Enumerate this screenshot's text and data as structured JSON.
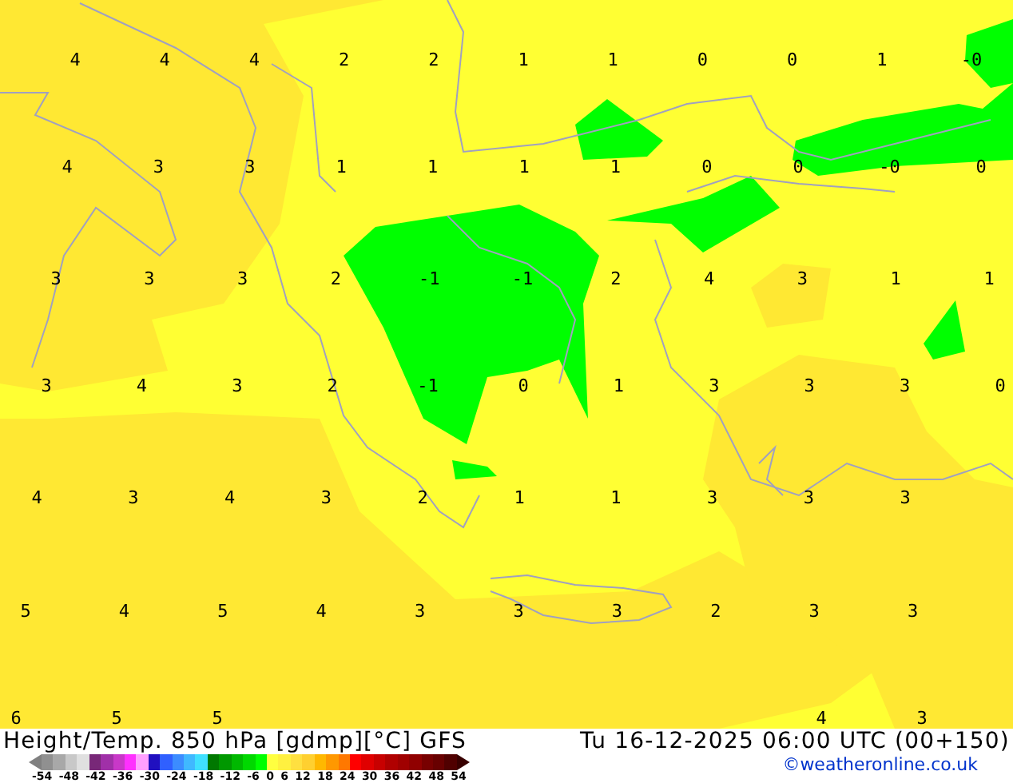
{
  "map": {
    "labels": [
      [
        "4",
        "4",
        "4",
        "2",
        "2",
        "1",
        "1",
        "0",
        "0",
        "1",
        "-0"
      ],
      [
        "4",
        "3",
        "3",
        "1",
        "1",
        "1",
        "1",
        "0",
        "0",
        "-0",
        "0"
      ],
      [
        "3",
        "3",
        "3",
        "2",
        "-1",
        "-1",
        "2",
        "4",
        "3",
        "1",
        "1"
      ],
      [
        "3",
        "4",
        "3",
        "2",
        "-1",
        "0",
        "1",
        "3",
        "3",
        "3",
        "0"
      ],
      [
        "4",
        "3",
        "4",
        "3",
        "2",
        "1",
        "1",
        "3",
        "3",
        "3"
      ],
      [
        "5",
        "4",
        "5",
        "4",
        "3",
        "3",
        "3",
        "2",
        "3",
        "3"
      ],
      [
        "6",
        "5",
        "5"
      ]
    ],
    "bottom_right_labels": [
      "4",
      "3"
    ]
  },
  "footer": {
    "title": "Height/Temp. 850 hPa [gdmp][°C] GFS",
    "datetime": "Tu 16-12-2025 06:00 UTC (00+150)",
    "credit": "©weatheronline.co.uk",
    "legend": {
      "swatches": [
        {
          "color": "#808080"
        },
        {
          "color": "#909090"
        },
        {
          "color": "#a8a8a8"
        },
        {
          "color": "#c8c8c8"
        },
        {
          "color": "#e0e0e0"
        },
        {
          "color": "#782878"
        },
        {
          "color": "#a030a8"
        },
        {
          "color": "#c838c8"
        },
        {
          "color": "#ff30ff"
        },
        {
          "color": "#ffa0ff"
        },
        {
          "color": "#2010c0"
        },
        {
          "color": "#3060ff"
        },
        {
          "color": "#3c8cff"
        },
        {
          "color": "#40b8ff"
        },
        {
          "color": "#40e0ff"
        },
        {
          "color": "#007800"
        },
        {
          "color": "#009800"
        },
        {
          "color": "#00b800"
        },
        {
          "color": "#00d800"
        },
        {
          "color": "#00ff00"
        },
        {
          "color": "#ffff40"
        },
        {
          "color": "#fff040"
        },
        {
          "color": "#ffe040"
        },
        {
          "color": "#ffd030"
        },
        {
          "color": "#ffb800"
        },
        {
          "color": "#ff9800"
        },
        {
          "color": "#ff7800"
        },
        {
          "color": "#ff0000"
        },
        {
          "color": "#e00000"
        },
        {
          "color": "#c80000"
        },
        {
          "color": "#b00000"
        },
        {
          "color": "#a00000"
        },
        {
          "color": "#900000"
        },
        {
          "color": "#780000"
        },
        {
          "color": "#680000"
        },
        {
          "color": "#500000"
        },
        {
          "color": "#380000"
        }
      ],
      "ticks": [
        "-54",
        "-48",
        "-42",
        "-36",
        "-30",
        "-24",
        "-18",
        "-12",
        "-6",
        "0",
        "6",
        "12",
        "18",
        "24",
        "30",
        "36",
        "42",
        "48",
        "54"
      ]
    }
  }
}
